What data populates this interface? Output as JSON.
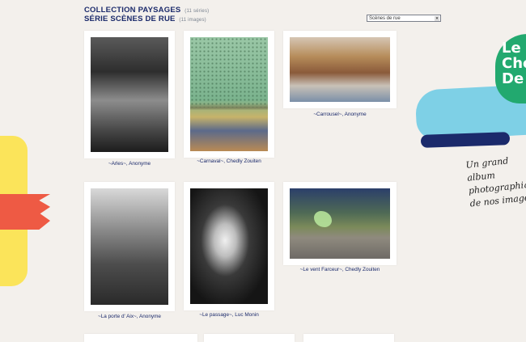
{
  "header": {
    "collection_label": "COLLECTION PAYSAGES",
    "collection_count": "(11 séries)",
    "serie_label": "SÉRIE SCÈNES DE RUE",
    "serie_count": "(11 images)"
  },
  "filter": {
    "selected": "Scènes de rue",
    "arrow": "▾"
  },
  "decoration": {
    "logo_text_lines": [
      "Le",
      "Che",
      "De"
    ],
    "tagline": "Un grand album photographique de nos images"
  },
  "gallery": {
    "items": [
      {
        "caption": "~Arles~, Anonyme"
      },
      {
        "caption": "~Carnaval~, Chedly Zouiten"
      },
      {
        "caption": "~Carrousel~, Anonyme"
      },
      {
        "caption": "~La porte d' Aix~, Anonyme"
      },
      {
        "caption": "~Le passage~, Luc Monin"
      },
      {
        "caption": "~Le vent Farceur~, Chedly Zouiten"
      }
    ]
  },
  "colors": {
    "accent_navy": "#1b2a6b",
    "background": "#f3f0ec",
    "deco_yellow": "#fbe45a",
    "deco_red": "#ee5a44",
    "deco_blue": "#7ed0e6",
    "deco_green": "#22a96f"
  }
}
